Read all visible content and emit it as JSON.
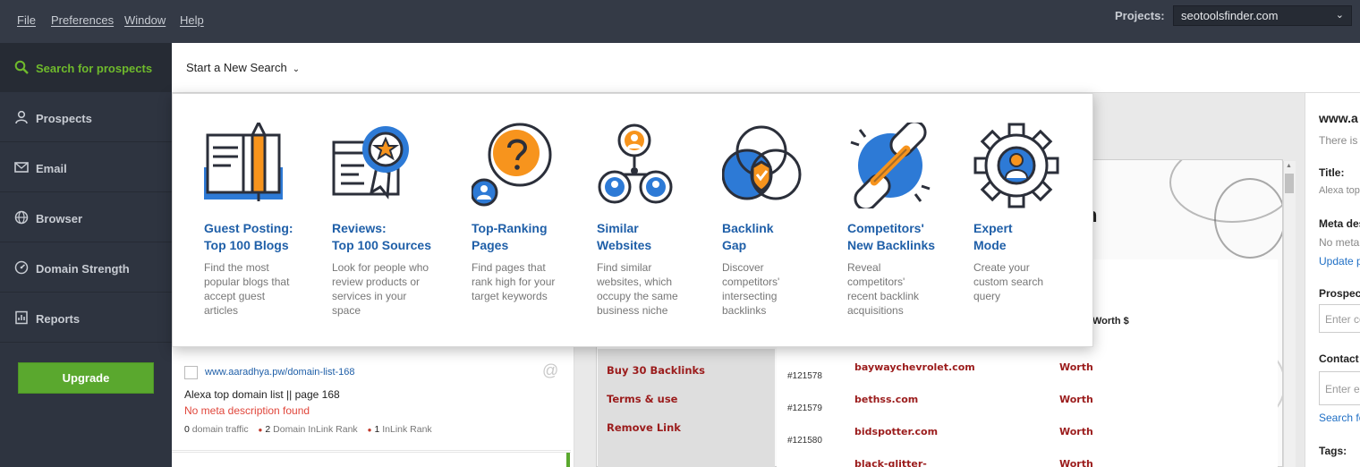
{
  "menubar": {
    "items": [
      "File",
      "Preferences",
      "Window",
      "Help"
    ],
    "projects_label": "Projects:",
    "project_selected": "seotoolsfinder.com"
  },
  "sidebar": {
    "items": [
      {
        "label": "Search for prospects",
        "icon": "search-icon"
      },
      {
        "label": "Prospects",
        "icon": "person-icon"
      },
      {
        "label": "Email",
        "icon": "email-icon"
      },
      {
        "label": "Browser",
        "icon": "globe-icon"
      },
      {
        "label": "Domain Strength",
        "icon": "gauge-icon"
      },
      {
        "label": "Reports",
        "icon": "reports-icon"
      }
    ],
    "upgrade_label": "Upgrade"
  },
  "toolbar": {
    "start_search": "Start a New Search"
  },
  "search_modes": [
    {
      "title": "Guest Posting:\nTop 100 Blogs",
      "description": "Find the most\npopular blogs that\naccept guest\narticles",
      "icon": "book-pencil-icon"
    },
    {
      "title": "Reviews:\nTop 100 Sources",
      "description": "Look for people who\nreview products or\nservices in your\nspace",
      "icon": "review-badge-icon"
    },
    {
      "title": "Top-Ranking\nPages",
      "description": "Find pages that\nrank high for your\ntarget keywords",
      "icon": "question-bubble-icon"
    },
    {
      "title": "Similar\nWebsites",
      "description": "Find similar\nwebsites, which\noccupy the same\nbusiness niche",
      "icon": "network-people-icon"
    },
    {
      "title": "Backlink\nGap",
      "description": "Discover\ncompetitors'\nintersecting\nbacklinks",
      "icon": "venn-shield-icon"
    },
    {
      "title": "Competitors'\nNew Backlinks",
      "description": "Reveal\ncompetitors'\nrecent backlink\nacquisitions",
      "icon": "chain-link-icon"
    },
    {
      "title": "Expert\nMode",
      "description": "Create your\ncustom search\nquery",
      "icon": "gear-person-icon"
    }
  ],
  "prospect": {
    "url": "www.aaradhya.pw/domain-list-168",
    "title": "Alexa top domain list || page 168",
    "meta": "No meta description found",
    "stat1_value": "0",
    "stat1_label": "domain traffic",
    "stat2_value": "2",
    "stat2_label": "Domain InLink Rank",
    "stat3_value": "1",
    "stat3_label": "InLink Rank"
  },
  "website": {
    "menu_links": [
      "Buy 30 Backlinks",
      "Terms & use",
      "Remove Link"
    ],
    "worth_header": "Worth $",
    "rows": [
      {
        "num": "#121578",
        "site": "baywaychevrolet.com",
        "worth": "Worth"
      },
      {
        "num": "#121579",
        "site": "bethss.com",
        "worth": "Worth"
      },
      {
        "num": "#121580",
        "site": "bidspotter.com",
        "worth": "Worth"
      },
      {
        "num": "",
        "site": "black-glitter-",
        "worth": "Worth"
      }
    ]
  },
  "right_panel": {
    "site": "www.a",
    "there_is": "There is",
    "title_label": "Title:",
    "title_value": "Alexa top",
    "meta_label": "Meta des",
    "meta_value": "No meta",
    "update_link": "Update p",
    "prospect_label": "Prospec",
    "prospect_placeholder": "Enter co",
    "contact_label": "Contact",
    "contact_placeholder": "Enter e",
    "search_link": "Search fo",
    "tags_label": "Tags:"
  },
  "colors": {
    "accent_green": "#5aa82e",
    "link_blue": "#1f5fa8",
    "icon_orange": "#f7941d",
    "icon_blue": "#2d7ad6",
    "dark_bg": "#343a46"
  }
}
